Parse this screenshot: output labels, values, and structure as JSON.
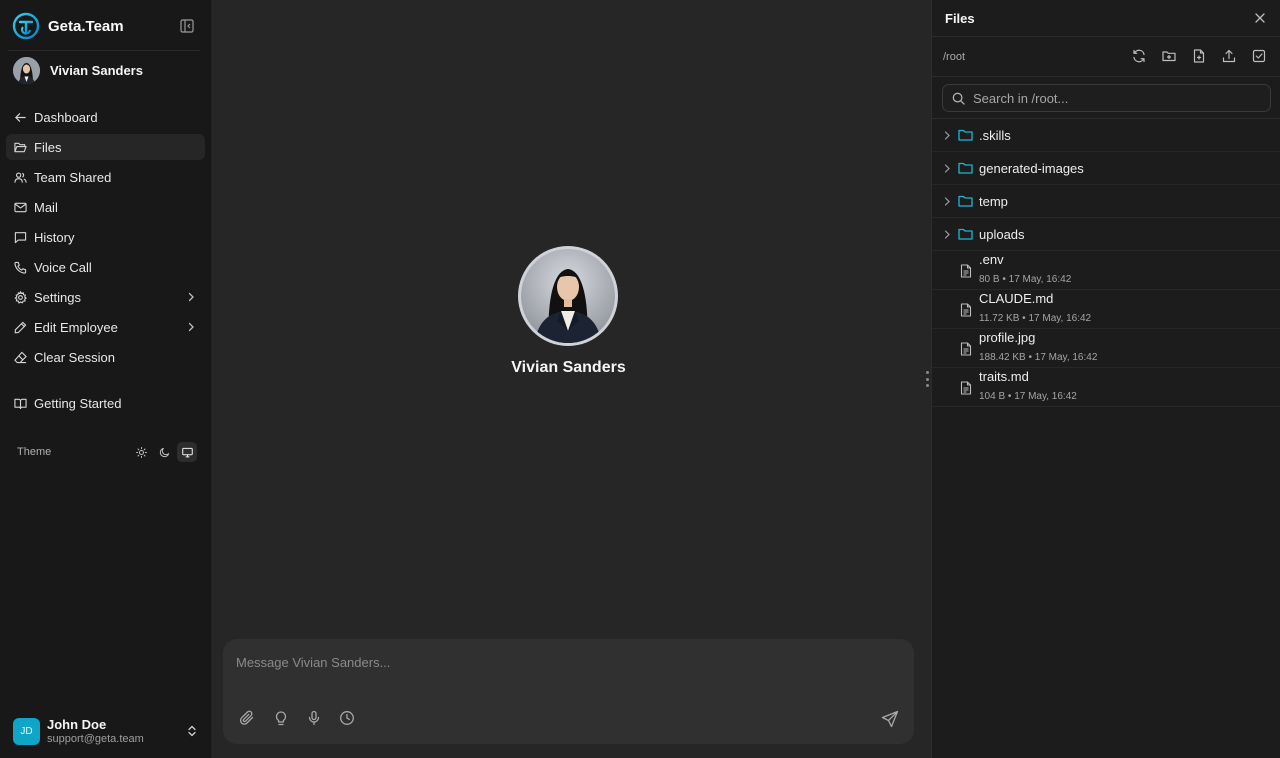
{
  "brand": {
    "name": "Geta.Team"
  },
  "employee": {
    "name": "Vivian Sanders"
  },
  "nav": {
    "items": [
      {
        "label": "Dashboard",
        "icon": "arrow-left-icon"
      },
      {
        "label": "Files",
        "icon": "folder-open-icon",
        "active": true
      },
      {
        "label": "Team Shared",
        "icon": "users-icon"
      },
      {
        "label": "Mail",
        "icon": "mail-icon"
      },
      {
        "label": "History",
        "icon": "chat-bubble-icon"
      },
      {
        "label": "Voice Call",
        "icon": "phone-icon"
      },
      {
        "label": "Settings",
        "icon": "gear-icon",
        "has_submenu": true
      },
      {
        "label": "Edit Employee",
        "icon": "pencil-icon",
        "has_submenu": true
      },
      {
        "label": "Clear Session",
        "icon": "eraser-icon"
      }
    ],
    "getting_started": "Getting Started"
  },
  "theme": {
    "label": "Theme",
    "options": [
      "light",
      "dark",
      "system"
    ],
    "selected": "system"
  },
  "user": {
    "initials": "JD",
    "name": "John Doe",
    "email": "support@geta.team"
  },
  "chat": {
    "profile_name": "Vivian Sanders",
    "placeholder": "Message Vivian Sanders..."
  },
  "files_panel": {
    "title": "Files",
    "path": "/root",
    "search_placeholder": "Search in /root...",
    "folders": [
      {
        "name": ".skills"
      },
      {
        "name": "generated-images"
      },
      {
        "name": "temp"
      },
      {
        "name": "uploads"
      }
    ],
    "files": [
      {
        "name": ".env",
        "meta": "80 B • 17 May, 16:42"
      },
      {
        "name": "CLAUDE.md",
        "meta": "11.72 KB • 17 May, 16:42"
      },
      {
        "name": "profile.jpg",
        "meta": "188.42 KB • 17 May, 16:42"
      },
      {
        "name": "traits.md",
        "meta": "104 B • 17 May, 16:42"
      }
    ]
  },
  "colors": {
    "accent": "#1fb6d4",
    "avatar_bg": "#0ea5c6",
    "sidebar_bg": "#181818",
    "main_bg": "#262626",
    "panel_bg": "#1c1c1c"
  }
}
